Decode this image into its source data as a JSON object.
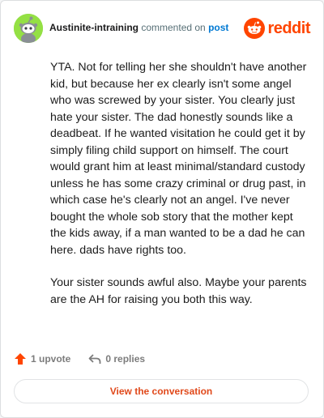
{
  "comment": {
    "author": "Austinite-intraining",
    "action_text": "commented on",
    "post_link": "post",
    "paragraphs": [
      "YTA. Not for telling her she shouldn't have another kid, but because her ex clearly isn't some angel who was screwed by your sister. You clearly just hate your sister. The dad honestly sounds like a deadbeat. If he wanted visitation he could get it by simply filing child support on himself. The court would grant him at least minimal/standard custody unless he has some crazy criminal or drug past, in which case he's clearly not an angel. I've never bought the whole sob story that the mother kept the kids away, if a man wanted to be a dad he can here. dads have rights too.",
      "Your sister sounds awful also. Maybe your parents are the AH for raising you both this way."
    ]
  },
  "brand": {
    "name": "reddit",
    "color": "#ff4500"
  },
  "footer": {
    "upvotes": "1 upvote",
    "replies": "0 replies",
    "view_button": "View the conversation"
  },
  "icons": {
    "avatar": "snoo-avatar-icon",
    "logo": "reddit-logo-icon",
    "upvote": "upvote-arrow-icon",
    "reply": "reply-arrow-icon"
  }
}
